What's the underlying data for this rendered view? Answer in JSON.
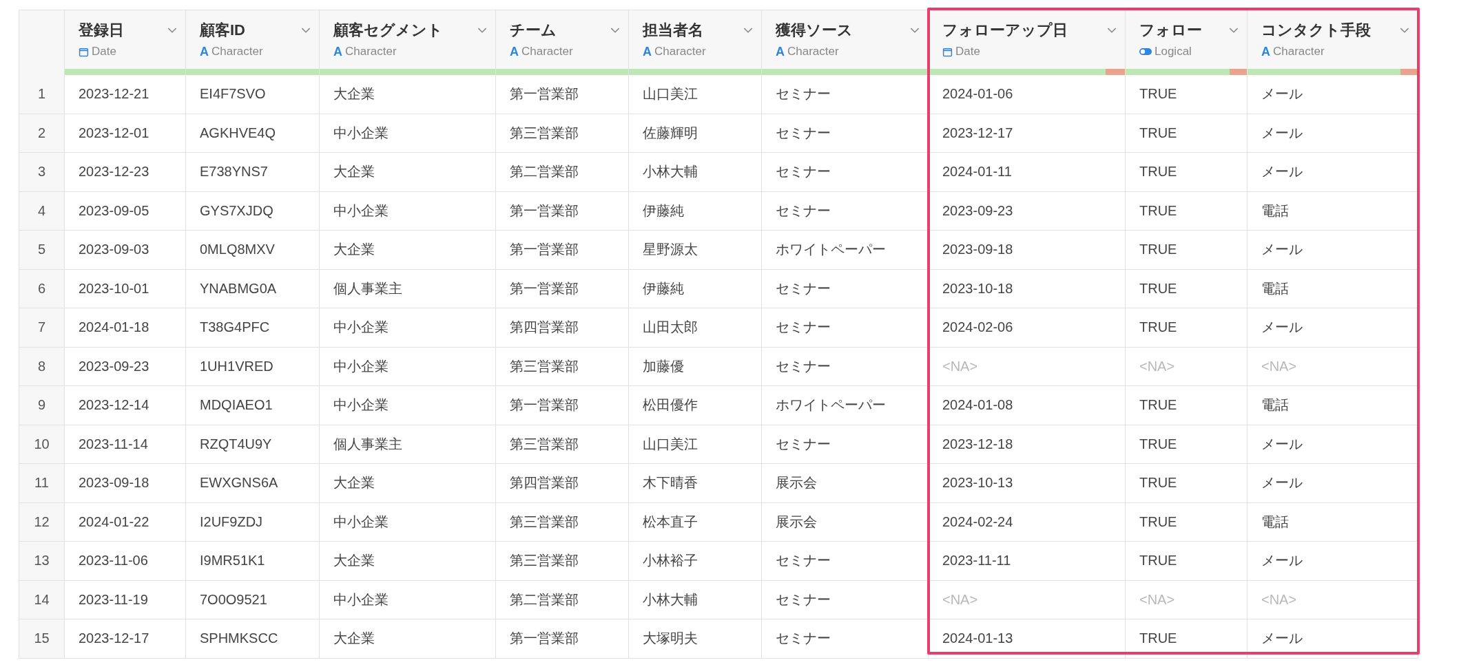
{
  "table": {
    "columns": [
      {
        "label": "登録日",
        "type": "Date",
        "kind": "date",
        "level": 1,
        "highlighted": false
      },
      {
        "label": "顧客ID",
        "type": "Character",
        "kind": "character",
        "icon_text": "A",
        "level": 1,
        "highlighted": false
      },
      {
        "label": "顧客セグメント",
        "type": "Character",
        "kind": "character",
        "icon_text": "A",
        "level": 1,
        "highlighted": false
      },
      {
        "label": "チーム",
        "type": "Character",
        "kind": "character",
        "icon_text": "A",
        "level": 1,
        "highlighted": false
      },
      {
        "label": "担当者名",
        "type": "Character",
        "kind": "character",
        "icon_text": "A",
        "level": 1,
        "highlighted": false
      },
      {
        "label": "獲得ソース",
        "type": "Character",
        "kind": "character",
        "icon_text": "A",
        "level": 1,
        "highlighted": false
      },
      {
        "label": "フォローアップ日",
        "type": "Date",
        "kind": "date",
        "level": 0.9,
        "highlighted": true
      },
      {
        "label": "フォロー",
        "type": "Logical",
        "kind": "logical",
        "level": 0.86,
        "highlighted": true
      },
      {
        "label": "コンタクト手段",
        "type": "Character",
        "kind": "character",
        "icon_text": "A",
        "level": 0.9,
        "highlighted": true
      }
    ],
    "rows": [
      {
        "number": "1",
        "cells": [
          "2023-12-21",
          "EI4F7SVO",
          "大企業",
          "第一営業部",
          "山口美江",
          "セミナー",
          "2024-01-06",
          "TRUE",
          "メール"
        ]
      },
      {
        "number": "2",
        "cells": [
          "2023-12-01",
          "AGKHVE4Q",
          "中小企業",
          "第三営業部",
          "佐藤輝明",
          "セミナー",
          "2023-12-17",
          "TRUE",
          "メール"
        ]
      },
      {
        "number": "3",
        "cells": [
          "2023-12-23",
          "E738YNS7",
          "大企業",
          "第二営業部",
          "小林大輔",
          "セミナー",
          "2024-01-11",
          "TRUE",
          "メール"
        ]
      },
      {
        "number": "4",
        "cells": [
          "2023-09-05",
          "GYS7XJDQ",
          "中小企業",
          "第一営業部",
          "伊藤純",
          "セミナー",
          "2023-09-23",
          "TRUE",
          "電話"
        ]
      },
      {
        "number": "5",
        "cells": [
          "2023-09-03",
          "0MLQ8MXV",
          "大企業",
          "第一営業部",
          "星野源太",
          "ホワイトペーパー",
          "2023-09-18",
          "TRUE",
          "メール"
        ]
      },
      {
        "number": "6",
        "cells": [
          "2023-10-01",
          "YNABMG0A",
          "個人事業主",
          "第一営業部",
          "伊藤純",
          "セミナー",
          "2023-10-18",
          "TRUE",
          "電話"
        ]
      },
      {
        "number": "7",
        "cells": [
          "2024-01-18",
          "T38G4PFC",
          "中小企業",
          "第四営業部",
          "山田太郎",
          "セミナー",
          "2024-02-06",
          "TRUE",
          "メール"
        ]
      },
      {
        "number": "8",
        "cells": [
          "2023-09-23",
          "1UH1VRED",
          "中小企業",
          "第三営業部",
          "加藤優",
          "セミナー",
          "<NA>",
          "<NA>",
          "<NA>"
        ]
      },
      {
        "number": "9",
        "cells": [
          "2023-12-14",
          "MDQIAEO1",
          "中小企業",
          "第一営業部",
          "松田優作",
          "ホワイトペーパー",
          "2024-01-08",
          "TRUE",
          "電話"
        ]
      },
      {
        "number": "10",
        "cells": [
          "2023-11-14",
          "RZQT4U9Y",
          "個人事業主",
          "第三営業部",
          "山口美江",
          "セミナー",
          "2023-12-18",
          "TRUE",
          "メール"
        ]
      },
      {
        "number": "11",
        "cells": [
          "2023-09-18",
          "EWXGNS6A",
          "大企業",
          "第四営業部",
          "木下晴香",
          "展示会",
          "2023-10-13",
          "TRUE",
          "メール"
        ]
      },
      {
        "number": "12",
        "cells": [
          "2024-01-22",
          "I2UF9ZDJ",
          "中小企業",
          "第三営業部",
          "松本直子",
          "展示会",
          "2024-02-24",
          "TRUE",
          "電話"
        ]
      },
      {
        "number": "13",
        "cells": [
          "2023-11-06",
          "I9MR51K1",
          "大企業",
          "第三営業部",
          "小林裕子",
          "セミナー",
          "2023-11-11",
          "TRUE",
          "メール"
        ]
      },
      {
        "number": "14",
        "cells": [
          "2023-11-19",
          "7O0O9521",
          "中小企業",
          "第二営業部",
          "小林大輔",
          "セミナー",
          "<NA>",
          "<NA>",
          "<NA>"
        ]
      },
      {
        "number": "15",
        "cells": [
          "2023-12-17",
          "SPHMKSCC",
          "大企業",
          "第一営業部",
          "大塚明夫",
          "セミナー",
          "2024-01-13",
          "TRUE",
          "メール"
        ]
      }
    ]
  }
}
